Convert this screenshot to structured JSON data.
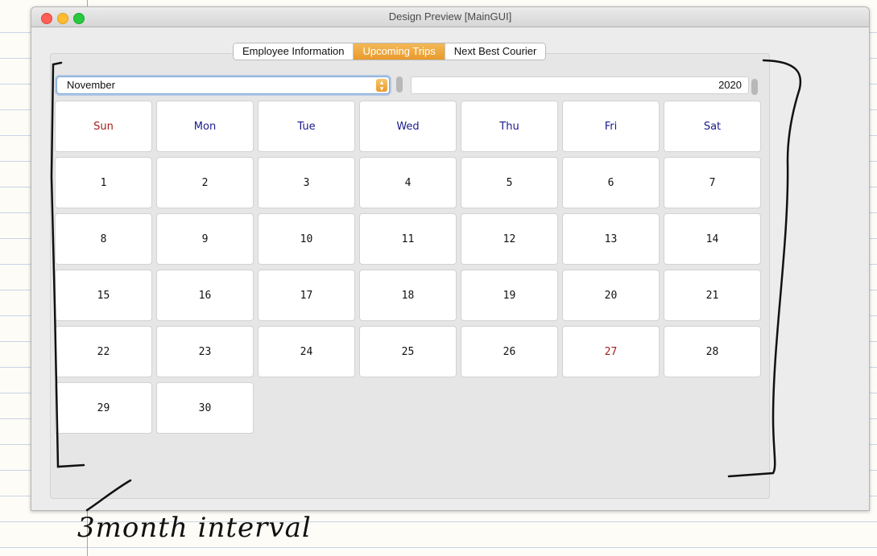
{
  "window": {
    "title": "Design Preview [MainGUI]"
  },
  "tabs": [
    {
      "label": "Employee Information",
      "active": false
    },
    {
      "label": "Upcoming Trips",
      "active": true
    },
    {
      "label": "Next Best Courier",
      "active": false
    }
  ],
  "calendar": {
    "month": "November",
    "year": "2020",
    "weekdays": [
      "Sun",
      "Mon",
      "Tue",
      "Wed",
      "Thu",
      "Fri",
      "Sat"
    ],
    "days": [
      "1",
      "2",
      "3",
      "4",
      "5",
      "6",
      "7",
      "8",
      "9",
      "10",
      "11",
      "12",
      "13",
      "14",
      "15",
      "16",
      "17",
      "18",
      "19",
      "20",
      "21",
      "22",
      "23",
      "24",
      "25",
      "26",
      "27",
      "28",
      "29",
      "30"
    ],
    "highlighted_day": "27"
  },
  "annotation": {
    "text": "3month interval"
  },
  "colors": {
    "accent": "#e99a2c",
    "weekday_header": "#1a1a8c",
    "sunday_header": "#a41c1c",
    "highlight_day": "#a41c1c"
  }
}
